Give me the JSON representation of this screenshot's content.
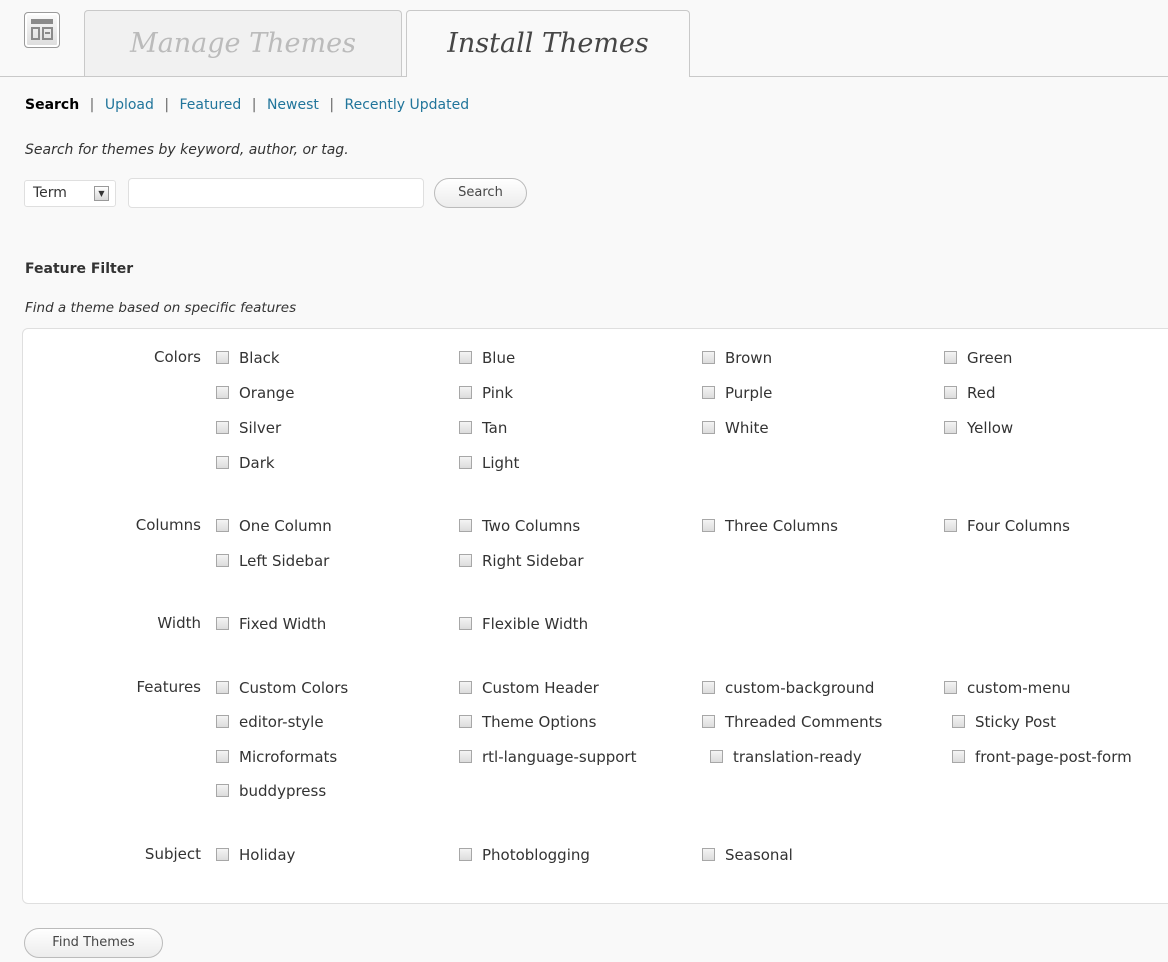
{
  "tabs": [
    {
      "label": "Manage Themes",
      "active": false
    },
    {
      "label": "Install Themes",
      "active": true
    }
  ],
  "subnav": {
    "current": "Search",
    "links": [
      "Upload",
      "Featured",
      "Newest",
      "Recently Updated"
    ],
    "separator": "|"
  },
  "search": {
    "help": "Search for themes by keyword, author, or tag.",
    "type_selected": "Term",
    "input_value": "",
    "button_label": "Search"
  },
  "feature_filter": {
    "title": "Feature Filter",
    "help": "Find a theme based on specific features",
    "groups": [
      {
        "label": "Colors",
        "options": [
          "Black",
          "Blue",
          "Brown",
          "Green",
          "Orange",
          "Pink",
          "Purple",
          "Red",
          "Silver",
          "Tan",
          "White",
          "Yellow",
          "Dark",
          "Light"
        ]
      },
      {
        "label": "Columns",
        "options": [
          "One Column",
          "Two Columns",
          "Three Columns",
          "Four Columns",
          "Left Sidebar",
          "Right Sidebar"
        ]
      },
      {
        "label": "Width",
        "options": [
          "Fixed Width",
          "Flexible Width"
        ]
      },
      {
        "label": "Features",
        "options": [
          "Custom Colors",
          "Custom Header",
          "custom-background",
          "custom-menu",
          "editor-style",
          "Theme Options",
          "Threaded Comments",
          "Sticky Post",
          "Microformats",
          "rtl-language-support",
          "translation-ready",
          "front-page-post-form",
          "buddypress"
        ]
      },
      {
        "label": "Subject",
        "options": [
          "Holiday",
          "Photoblogging",
          "Seasonal"
        ]
      }
    ],
    "submit_label": "Find Themes"
  }
}
